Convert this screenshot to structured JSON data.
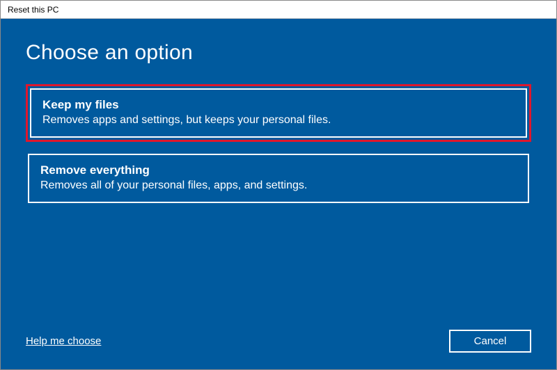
{
  "window": {
    "title": "Reset this PC"
  },
  "page": {
    "heading": "Choose an option"
  },
  "options": {
    "keep": {
      "title": "Keep my files",
      "desc": "Removes apps and settings, but keeps your personal files."
    },
    "remove": {
      "title": "Remove everything",
      "desc": "Removes all of your personal files, apps, and settings."
    }
  },
  "footer": {
    "help_link": "Help me choose",
    "cancel_label": "Cancel"
  },
  "colors": {
    "background": "#005a9e",
    "highlight_border": "#e0172c",
    "text": "#ffffff"
  }
}
